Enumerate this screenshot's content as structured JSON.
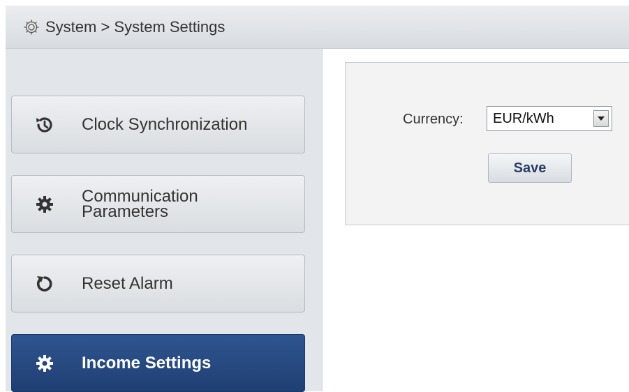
{
  "header": {
    "breadcrumb": "System > System Settings",
    "icon": "gear-outline-icon"
  },
  "sidebar": {
    "items": [
      {
        "label": "Clock Synchronization",
        "icon": "clock-history-icon",
        "active": false
      },
      {
        "label": "Communication Parameters",
        "icon": "gear-icon",
        "active": false
      },
      {
        "label": "Reset Alarm",
        "icon": "reset-icon",
        "active": false
      },
      {
        "label": "Income Settings",
        "icon": "gear-icon",
        "active": true
      }
    ]
  },
  "main": {
    "currency_label": "Currency:",
    "currency_value": "EUR/kWh",
    "save_label": "Save"
  },
  "colors": {
    "active_item_bg": "#2a4c84",
    "header_bg": "#e1e4e8",
    "sidebar_bg": "#e2e5e9"
  }
}
